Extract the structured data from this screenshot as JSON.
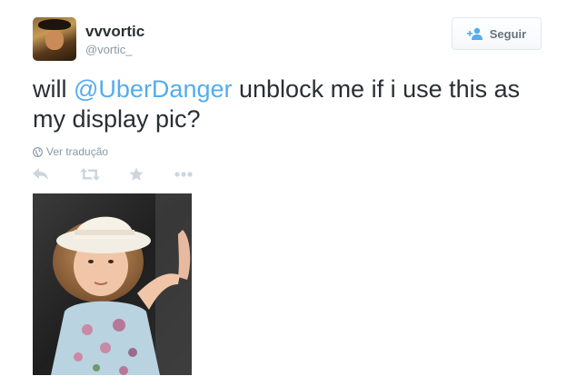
{
  "user": {
    "display_name": "vvvortic",
    "handle": "@vortic_"
  },
  "follow_button": {
    "label": "Seguir"
  },
  "tweet": {
    "text_before": "will ",
    "mention": "@UberDanger",
    "text_after": " unblock me if i use this as my display pic?"
  },
  "translate": {
    "label": "Ver tradução"
  },
  "actions": [
    "reply-icon",
    "retweet-icon",
    "favorite-icon",
    "more-icon"
  ],
  "colors": {
    "link": "#55acee",
    "text": "#292f33",
    "muted": "#8899a6",
    "action_icon": "#ccd6dd"
  }
}
